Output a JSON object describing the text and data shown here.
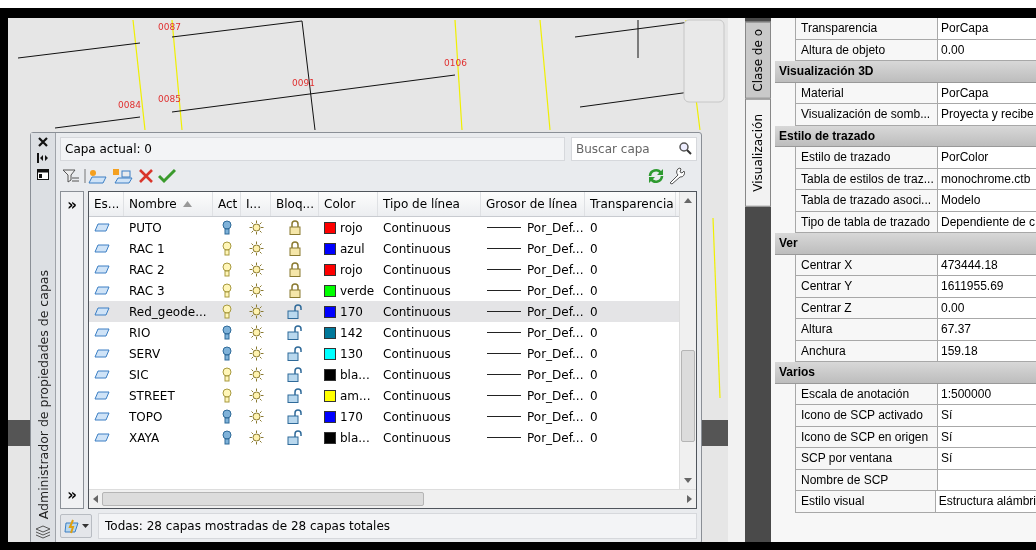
{
  "canvas": {
    "point_labels": [
      "0087",
      "0106",
      "0091",
      "0085",
      "0084"
    ]
  },
  "layer_palette": {
    "title": "Administrador de propiedades de capas",
    "current_layer": "Capa actual: 0",
    "search": {
      "placeholder": "Buscar capa"
    },
    "filter_pane_toggles": [
      "»",
      "»"
    ],
    "columns": [
      {
        "label": "Es..."
      },
      {
        "label": "Nombre",
        "sorted": true
      },
      {
        "label": "Act"
      },
      {
        "label": "I..."
      },
      {
        "label": "Bloq..."
      },
      {
        "label": "Color"
      },
      {
        "label": "Tipo de línea"
      },
      {
        "label": "Grosor de línea"
      },
      {
        "label": "Transparencia"
      }
    ],
    "layers": [
      {
        "name": "PUTO",
        "on": false,
        "frozen": false,
        "locked": true,
        "color": "#ff0000",
        "color_name": "rojo",
        "linetype": "Continuous",
        "lineweight": "Por_Def...",
        "transparency": "0",
        "selected": false
      },
      {
        "name": "RAC 1",
        "on": true,
        "frozen": false,
        "locked": true,
        "color": "#0000ff",
        "color_name": "azul",
        "linetype": "Continuous",
        "lineweight": "Por_Def...",
        "transparency": "0",
        "selected": false
      },
      {
        "name": "RAC 2",
        "on": true,
        "frozen": false,
        "locked": true,
        "color": "#ff0000",
        "color_name": "rojo",
        "linetype": "Continuous",
        "lineweight": "Por_Def...",
        "transparency": "0",
        "selected": false
      },
      {
        "name": "RAC 3",
        "on": true,
        "frozen": false,
        "locked": true,
        "color": "#00ff00",
        "color_name": "verde",
        "linetype": "Continuous",
        "lineweight": "Por_Def...",
        "transparency": "0",
        "selected": false
      },
      {
        "name": "Red_geode...",
        "on": true,
        "frozen": false,
        "locked": false,
        "color": "#0000ff",
        "color_name": "170",
        "linetype": "Continuous",
        "lineweight": "Por_Def...",
        "transparency": "0",
        "selected": true
      },
      {
        "name": "RIO",
        "on": false,
        "frozen": false,
        "locked": false,
        "color": "#00789a",
        "color_name": "142",
        "linetype": "Continuous",
        "lineweight": "Por_Def...",
        "transparency": "0",
        "selected": false
      },
      {
        "name": "SERV",
        "on": false,
        "frozen": false,
        "locked": false,
        "color": "#00ffff",
        "color_name": "130",
        "linetype": "Continuous",
        "lineweight": "Por_Def...",
        "transparency": "0",
        "selected": false
      },
      {
        "name": "SIC",
        "on": true,
        "frozen": false,
        "locked": false,
        "color": "#000000",
        "color_name": "bla...",
        "linetype": "Continuous",
        "lineweight": "Por_Def...",
        "transparency": "0",
        "selected": false
      },
      {
        "name": "STREET",
        "on": true,
        "frozen": false,
        "locked": false,
        "color": "#ffff00",
        "color_name": "am...",
        "linetype": "Continuous",
        "lineweight": "Por_Def...",
        "transparency": "0",
        "selected": false
      },
      {
        "name": "TOPO",
        "on": false,
        "frozen": false,
        "locked": false,
        "color": "#0000ff",
        "color_name": "170",
        "linetype": "Continuous",
        "lineweight": "Por_Def...",
        "transparency": "0",
        "selected": false
      },
      {
        "name": "XAYA",
        "on": false,
        "frozen": false,
        "locked": false,
        "color": "#000000",
        "color_name": "bla...",
        "linetype": "Continuous",
        "lineweight": "Por_Def...",
        "transparency": "0",
        "selected": false
      }
    ],
    "status": "Todas: 28 capas mostradas de 28 capas totales"
  },
  "properties": {
    "tabs": [
      {
        "label": "Clase de o",
        "selected": false
      },
      {
        "label": "Visualización",
        "selected": true
      }
    ],
    "leading_rows": [
      {
        "name": "Transparencia",
        "value": "PorCapa"
      },
      {
        "name": "Altura de objeto",
        "value": "0.00"
      }
    ],
    "sections": [
      {
        "title": "Visualización 3D",
        "rows": [
          {
            "name": "Material",
            "value": "PorCapa"
          },
          {
            "name": "Visualización de somb...",
            "value": "Proyecta y recibe"
          }
        ]
      },
      {
        "title": "Estilo de trazado",
        "rows": [
          {
            "name": "Estilo de trazado",
            "value": "PorColor"
          },
          {
            "name": "Tabla de estilos de traz...",
            "value": "monochrome.ctb"
          },
          {
            "name": "Tabla de trazado asoci...",
            "value": "Modelo"
          },
          {
            "name": "Tipo de tabla de trazado",
            "value": "Dependiente de c"
          }
        ]
      },
      {
        "title": "Ver",
        "rows": [
          {
            "name": "Centrar X",
            "value": "473444.18"
          },
          {
            "name": "Centrar Y",
            "value": "1611955.69"
          },
          {
            "name": "Centrar Z",
            "value": "0.00"
          },
          {
            "name": "Altura",
            "value": "67.37"
          },
          {
            "name": "Anchura",
            "value": "159.18"
          }
        ]
      },
      {
        "title": "Varios",
        "rows": [
          {
            "name": "Escala de anotación",
            "value": "1:500000"
          },
          {
            "name": "Icono de SCP activado",
            "value": "Sí"
          },
          {
            "name": "Icono de SCP en origen",
            "value": "Sí"
          },
          {
            "name": "SCP por ventana",
            "value": "Sí"
          },
          {
            "name": "Nombre de SCP"
          },
          {
            "name": "Estilo visual",
            "value": "Estructura alámbri"
          }
        ]
      }
    ]
  }
}
